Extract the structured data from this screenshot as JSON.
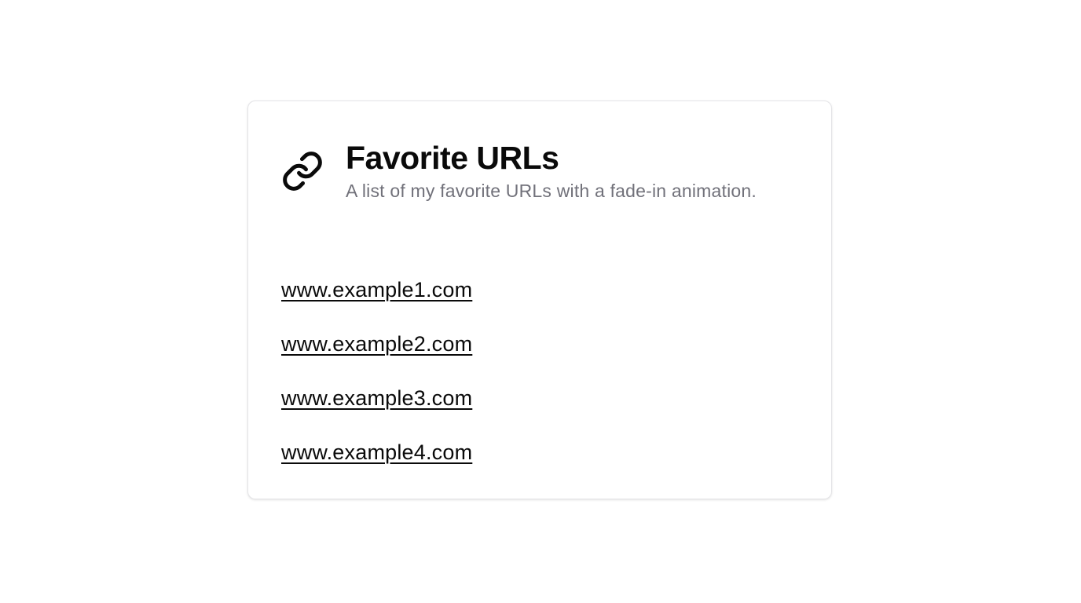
{
  "card": {
    "icon": "link-icon",
    "title": "Favorite URLs",
    "subtitle": "A list of my favorite URLs with a fade-in animation."
  },
  "links": [
    {
      "label": "www.example1.com"
    },
    {
      "label": "www.example2.com"
    },
    {
      "label": "www.example3.com"
    },
    {
      "label": "www.example4.com"
    }
  ],
  "colors": {
    "text": "#0a0a0a",
    "muted": "#71717a",
    "border": "#e4e4e7",
    "background": "#ffffff"
  }
}
